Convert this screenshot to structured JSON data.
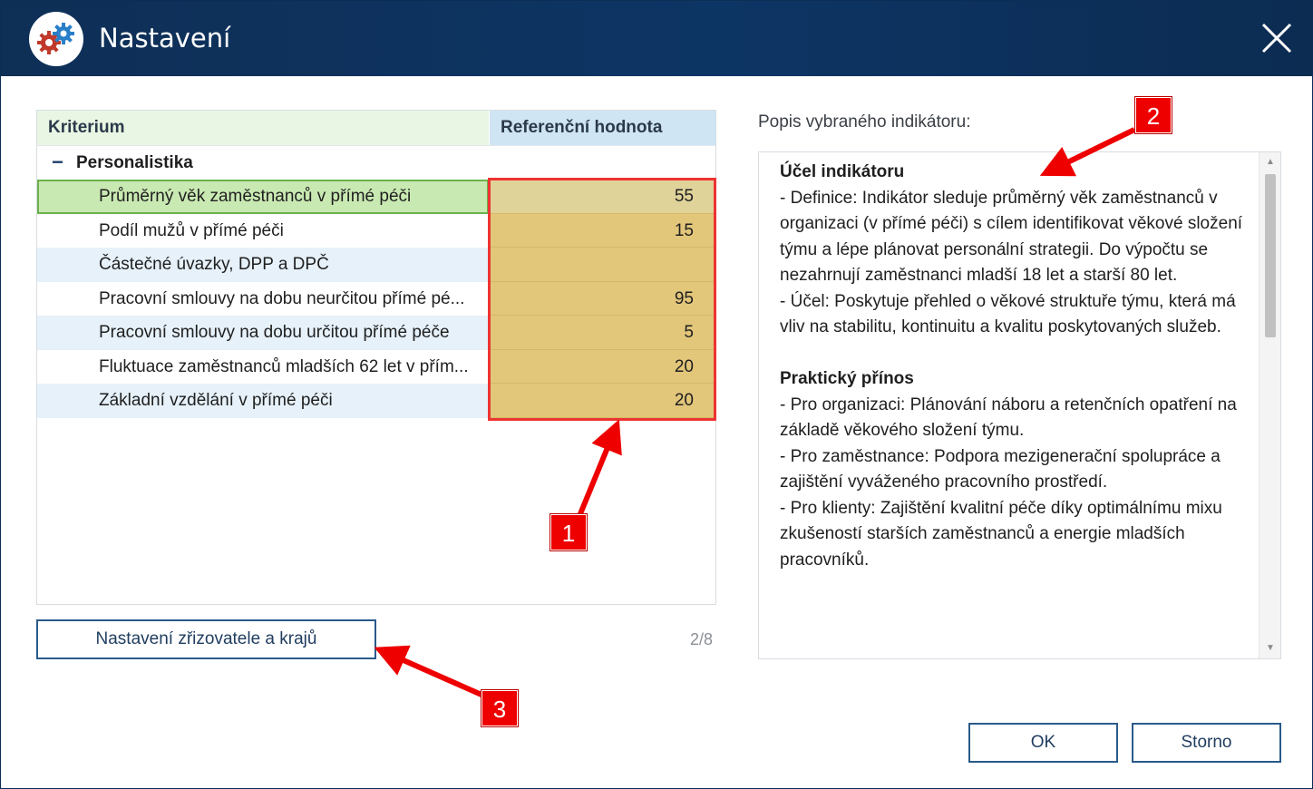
{
  "window": {
    "title": "Nastavení"
  },
  "table": {
    "col_criterium": "Kriterium",
    "col_reference": "Referenční hodnota",
    "group": {
      "toggle": "−",
      "label": "Personalistika"
    },
    "rows": [
      {
        "name": "Průměrný věk zaměstnanců v přímé péči",
        "value": "55"
      },
      {
        "name": "Podíl mužů v přímé péči",
        "value": "15"
      },
      {
        "name": "Částečné úvazky, DPP a DPČ",
        "value": ""
      },
      {
        "name": "Pracovní smlouvy na dobu neurčitou přímé pé...",
        "value": "95"
      },
      {
        "name": "Pracovní smlouvy na dobu určitou přímé péče",
        "value": "5"
      },
      {
        "name": "Fluktuace zaměstnanců mladších 62 let v přím...",
        "value": "20"
      },
      {
        "name": "Základní vzdělání v přímé péči",
        "value": "20"
      }
    ]
  },
  "buttons": {
    "settings_label": "Nastavení zřizovatele a krajů",
    "ok_label": "OK",
    "cancel_label": "Storno"
  },
  "pager": "2/8",
  "description": {
    "label": "Popis vybraného indikátoru:",
    "section1_title": "Účel indikátoru",
    "section1_lines": [
      "- Definice: Indikátor sleduje průměrný věk zaměstnanců v organizaci (v přímé péči) s cílem identifikovat věkové složení týmu a lépe plánovat personální strategii. Do výpočtu se nezahrnují zaměstnanci mladší 18 let a starší 80 let.",
      "- Účel: Poskytuje přehled o věkové struktuře týmu, která má vliv na stabilitu, kontinuitu a kvalitu poskytovaných služeb."
    ],
    "section2_title": "Praktický přínos",
    "section2_lines": [
      "- Pro organizaci: Plánování náboru a retenčních opatření na základě věkového složení týmu.",
      "- Pro zaměstnance: Podpora mezigenerační spolupráce a zajištění vyváženého pracovního prostředí.",
      "- Pro klienty: Zajištění kvalitní péče díky optimálnímu mixu zkušeností starších zaměstnanců a energie mladších pracovníků."
    ]
  },
  "callouts": [
    "1",
    "2",
    "3"
  ],
  "colors": {
    "titlebar": "#0d3564",
    "accent": "#e00000",
    "value_cell": "#e2c67a",
    "selected_row": "#c9e9b2"
  },
  "icons": {
    "app": "gears-icon",
    "close": "close-icon",
    "collapse": "minus-icon"
  }
}
